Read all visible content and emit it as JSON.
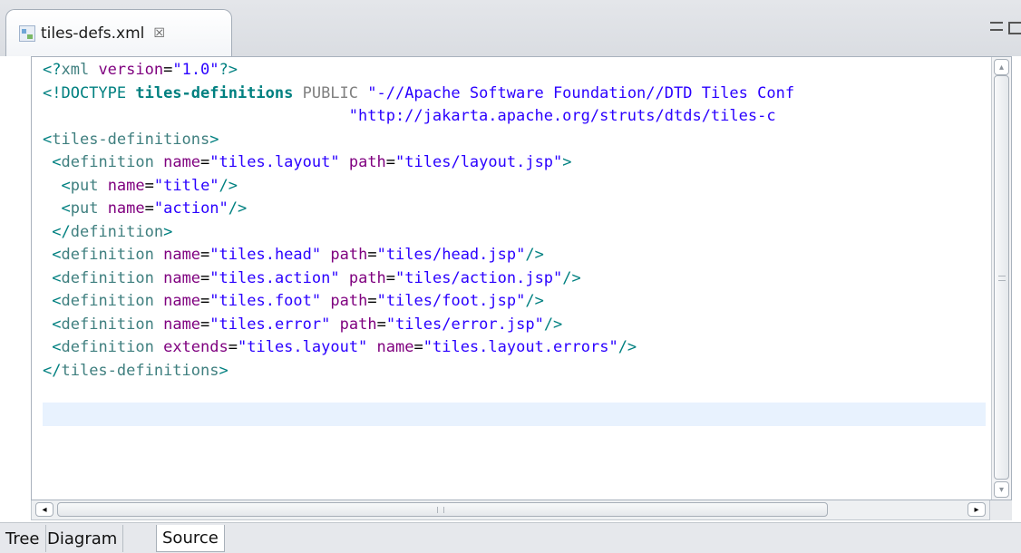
{
  "tab": {
    "title": "tiles-defs.xml",
    "close_glyph": "☒"
  },
  "editor": {
    "lines": [
      [
        {
          "c": "t-bracket",
          "t": "<?"
        },
        {
          "c": "t-tag",
          "t": "xml "
        },
        {
          "c": "t-attr",
          "t": "version"
        },
        {
          "c": "",
          "t": "="
        },
        {
          "c": "t-val",
          "t": "\"1.0\""
        },
        {
          "c": "t-bracket",
          "t": "?>"
        }
      ],
      [
        {
          "c": "t-doctype",
          "t": "<!DOCTYPE "
        },
        {
          "c": "t-root",
          "t": "tiles-definitions"
        },
        {
          "c": "t-public",
          "t": " PUBLIC "
        },
        {
          "c": "t-val",
          "t": "\"-//Apache Software Foundation//DTD Tiles Conf"
        }
      ],
      [
        {
          "c": "",
          "t": "                                 "
        },
        {
          "c": "t-val",
          "t": "\"http://jakarta.apache.org/struts/dtds/tiles-c"
        }
      ],
      [
        {
          "c": "t-bracket",
          "t": "<"
        },
        {
          "c": "t-tag",
          "t": "tiles-definitions"
        },
        {
          "c": "t-bracket",
          "t": ">"
        }
      ],
      [
        {
          "c": "",
          "t": " "
        },
        {
          "c": "t-bracket",
          "t": "<"
        },
        {
          "c": "t-tag",
          "t": "definition "
        },
        {
          "c": "t-attr",
          "t": "name"
        },
        {
          "c": "",
          "t": "="
        },
        {
          "c": "t-val",
          "t": "\"tiles.layout\""
        },
        {
          "c": "",
          "t": " "
        },
        {
          "c": "t-attr",
          "t": "path"
        },
        {
          "c": "",
          "t": "="
        },
        {
          "c": "t-val",
          "t": "\"tiles/layout.jsp\""
        },
        {
          "c": "t-bracket",
          "t": ">"
        }
      ],
      [
        {
          "c": "",
          "t": "  "
        },
        {
          "c": "t-bracket",
          "t": "<"
        },
        {
          "c": "t-tag",
          "t": "put "
        },
        {
          "c": "t-attr",
          "t": "name"
        },
        {
          "c": "",
          "t": "="
        },
        {
          "c": "t-val",
          "t": "\"title\""
        },
        {
          "c": "t-bracket",
          "t": "/>"
        }
      ],
      [
        {
          "c": "",
          "t": "  "
        },
        {
          "c": "t-bracket",
          "t": "<"
        },
        {
          "c": "t-tag",
          "t": "put "
        },
        {
          "c": "t-attr",
          "t": "name"
        },
        {
          "c": "",
          "t": "="
        },
        {
          "c": "t-val",
          "t": "\"action\""
        },
        {
          "c": "t-bracket",
          "t": "/>"
        }
      ],
      [
        {
          "c": "",
          "t": " "
        },
        {
          "c": "t-bracket",
          "t": "</"
        },
        {
          "c": "t-tag",
          "t": "definition"
        },
        {
          "c": "t-bracket",
          "t": ">"
        }
      ],
      [
        {
          "c": "",
          "t": " "
        },
        {
          "c": "t-bracket",
          "t": "<"
        },
        {
          "c": "t-tag",
          "t": "definition "
        },
        {
          "c": "t-attr",
          "t": "name"
        },
        {
          "c": "",
          "t": "="
        },
        {
          "c": "t-val",
          "t": "\"tiles.head\""
        },
        {
          "c": "",
          "t": " "
        },
        {
          "c": "t-attr",
          "t": "path"
        },
        {
          "c": "",
          "t": "="
        },
        {
          "c": "t-val",
          "t": "\"tiles/head.jsp\""
        },
        {
          "c": "t-bracket",
          "t": "/>"
        }
      ],
      [
        {
          "c": "",
          "t": " "
        },
        {
          "c": "t-bracket",
          "t": "<"
        },
        {
          "c": "t-tag",
          "t": "definition "
        },
        {
          "c": "t-attr",
          "t": "name"
        },
        {
          "c": "",
          "t": "="
        },
        {
          "c": "t-val",
          "t": "\"tiles.action\""
        },
        {
          "c": "",
          "t": " "
        },
        {
          "c": "t-attr",
          "t": "path"
        },
        {
          "c": "",
          "t": "="
        },
        {
          "c": "t-val",
          "t": "\"tiles/action.jsp\""
        },
        {
          "c": "t-bracket",
          "t": "/>"
        }
      ],
      [
        {
          "c": "",
          "t": " "
        },
        {
          "c": "t-bracket",
          "t": "<"
        },
        {
          "c": "t-tag",
          "t": "definition "
        },
        {
          "c": "t-attr",
          "t": "name"
        },
        {
          "c": "",
          "t": "="
        },
        {
          "c": "t-val",
          "t": "\"tiles.foot\""
        },
        {
          "c": "",
          "t": " "
        },
        {
          "c": "t-attr",
          "t": "path"
        },
        {
          "c": "",
          "t": "="
        },
        {
          "c": "t-val",
          "t": "\"tiles/foot.jsp\""
        },
        {
          "c": "t-bracket",
          "t": "/>"
        }
      ],
      [
        {
          "c": "",
          "t": " "
        },
        {
          "c": "t-bracket",
          "t": "<"
        },
        {
          "c": "t-tag",
          "t": "definition "
        },
        {
          "c": "t-attr",
          "t": "name"
        },
        {
          "c": "",
          "t": "="
        },
        {
          "c": "t-val",
          "t": "\"tiles.error\""
        },
        {
          "c": "",
          "t": " "
        },
        {
          "c": "t-attr",
          "t": "path"
        },
        {
          "c": "",
          "t": "="
        },
        {
          "c": "t-val",
          "t": "\"tiles/error.jsp\""
        },
        {
          "c": "t-bracket",
          "t": "/>"
        }
      ],
      [
        {
          "c": "",
          "t": " "
        },
        {
          "c": "t-bracket",
          "t": "<"
        },
        {
          "c": "t-tag",
          "t": "definition "
        },
        {
          "c": "t-attr",
          "t": "extends"
        },
        {
          "c": "",
          "t": "="
        },
        {
          "c": "t-val",
          "t": "\"tiles.layout\""
        },
        {
          "c": "",
          "t": " "
        },
        {
          "c": "t-attr",
          "t": "name"
        },
        {
          "c": "",
          "t": "="
        },
        {
          "c": "t-val",
          "t": "\"tiles.layout.errors\""
        },
        {
          "c": "t-bracket",
          "t": "/>"
        }
      ],
      [
        {
          "c": "t-bracket",
          "t": "</"
        },
        {
          "c": "t-tag",
          "t": "tiles-definitions"
        },
        {
          "c": "t-bracket",
          "t": ">"
        }
      ],
      [
        {
          "c": "",
          "t": ""
        }
      ]
    ]
  },
  "scrollbars": {
    "up_glyph": "▴",
    "down_glyph": "▾",
    "left_glyph": "◂",
    "right_glyph": "▸"
  },
  "bottom_tabs": [
    {
      "label": "Tree",
      "active": false
    },
    {
      "label": "Diagram",
      "active": false
    },
    {
      "label": "Source",
      "active": true
    }
  ],
  "colors": {
    "tag": "#3f7f7f",
    "attribute": "#7f007f",
    "value": "#2a00ff",
    "current_line": "#e8f2fe"
  }
}
